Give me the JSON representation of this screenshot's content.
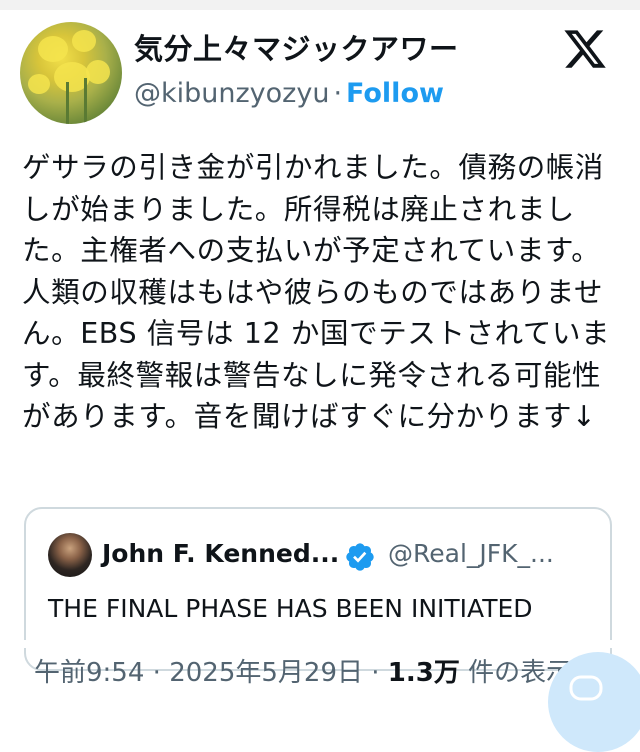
{
  "author": {
    "display_name": "気分上々マジックアワー",
    "handle": "@kibunzyozyu",
    "separator": "·",
    "follow_label": "Follow"
  },
  "header": {
    "logo_icon": "x-logo-icon"
  },
  "tweet": {
    "text": "ゲサラの引き金が引かれました。債務の帳消しが始まりました。所得税は廃止されました。主権者への支払いが予定されています。人類の収穫はもはや彼らのものではありません。EBS 信号は 12 か国でテストされています。最終警報は警告なしに発令される可能性があります。音を聞けばすぐに分かります↓"
  },
  "quote": {
    "author_name": "John F. Kenned...",
    "verified_icon": "verified-badge-icon",
    "handle": "@Real_JFK_...",
    "text": "THE FINAL PHASE HAS BEEN INITIATED"
  },
  "meta": {
    "time": "午前9:54",
    "sep1": "·",
    "date": "2025年5月29日",
    "sep2": "·",
    "view_count": "1.3万",
    "views_label": "件の表示"
  },
  "colors": {
    "accent": "#1d9bf0",
    "text": "#0f1419",
    "secondary": "#536471",
    "border": "#cfd9de"
  }
}
